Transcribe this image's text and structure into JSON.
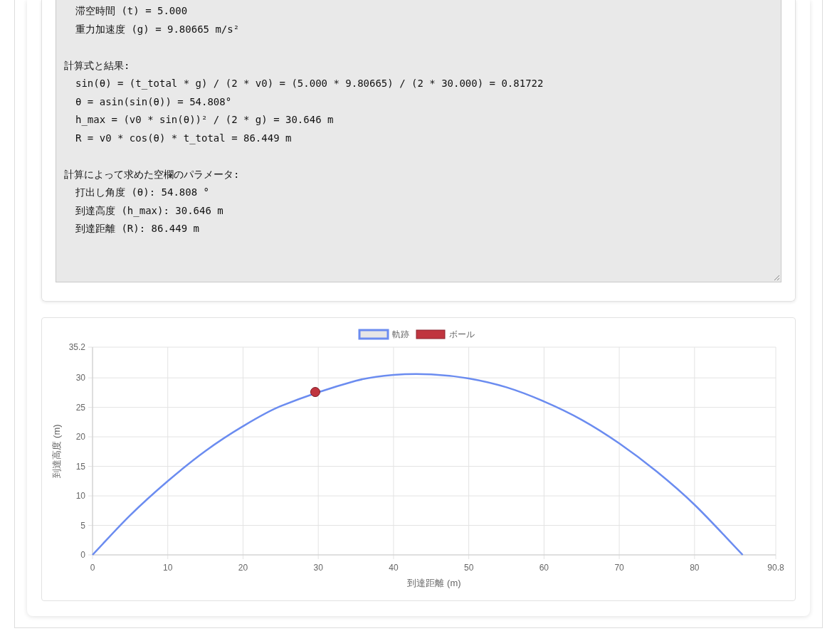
{
  "result_box": {
    "sections": [
      {
        "lines": [
          "滞空時間 (t) = 5.000",
          "重力加速度 (g) = 9.80665 m/s²"
        ]
      },
      {
        "heading": "計算式と結果:",
        "lines": [
          "sin(θ) = (t_total * g) / (2 * v0) = (5.000 * 9.80665) / (2 * 30.000) = 0.81722",
          "θ = asin(sin(θ)) = 54.808°",
          "h_max = (v0 * sin(θ))² / (2 * g) = 30.646 m",
          "R = v0 * cos(θ) * t_total = 86.449 m"
        ]
      },
      {
        "heading": "計算によって求めた空欄のパラメータ:",
        "lines": [
          "打出し角度 (θ): 54.808 °",
          "到達高度 (h_max): 30.646 m",
          "到達距離 (R): 86.449 m"
        ]
      }
    ]
  },
  "trajectory_chart": {
    "chart_data": {
      "type": "line",
      "xlabel": "到達距離 (m)",
      "ylabel": "到達高度 (m)",
      "grid": true,
      "legend": true,
      "x": [
        0,
        5,
        10,
        15,
        20,
        25,
        29.6,
        35,
        40,
        45,
        50,
        55,
        60,
        65,
        70,
        75,
        80,
        86.4
      ],
      "series": [
        {
          "name": "軌跡",
          "color": "#6b8cf0",
          "values": [
            0,
            6.7,
            12.5,
            17.6,
            21.8,
            25.2,
            null,
            29.5,
            30.5,
            30.6,
            29.9,
            28.4,
            26,
            22.9,
            18.9,
            14.1,
            8.5,
            0
          ]
        },
        {
          "name": "ボール",
          "color": "#c0353f",
          "marker": "circle",
          "values": [
            null,
            null,
            null,
            null,
            null,
            null,
            27.6,
            null,
            null,
            null,
            null,
            null,
            null,
            null,
            null,
            null,
            null,
            null
          ]
        }
      ],
      "xlim": [
        0,
        90.8
      ],
      "ylim": [
        0,
        35.2
      ],
      "xticks": [
        0,
        10,
        20,
        30,
        40,
        50,
        60,
        70,
        80,
        90.8
      ],
      "yticks": [
        0,
        5,
        10,
        15,
        20,
        25,
        30,
        35.2
      ]
    }
  }
}
